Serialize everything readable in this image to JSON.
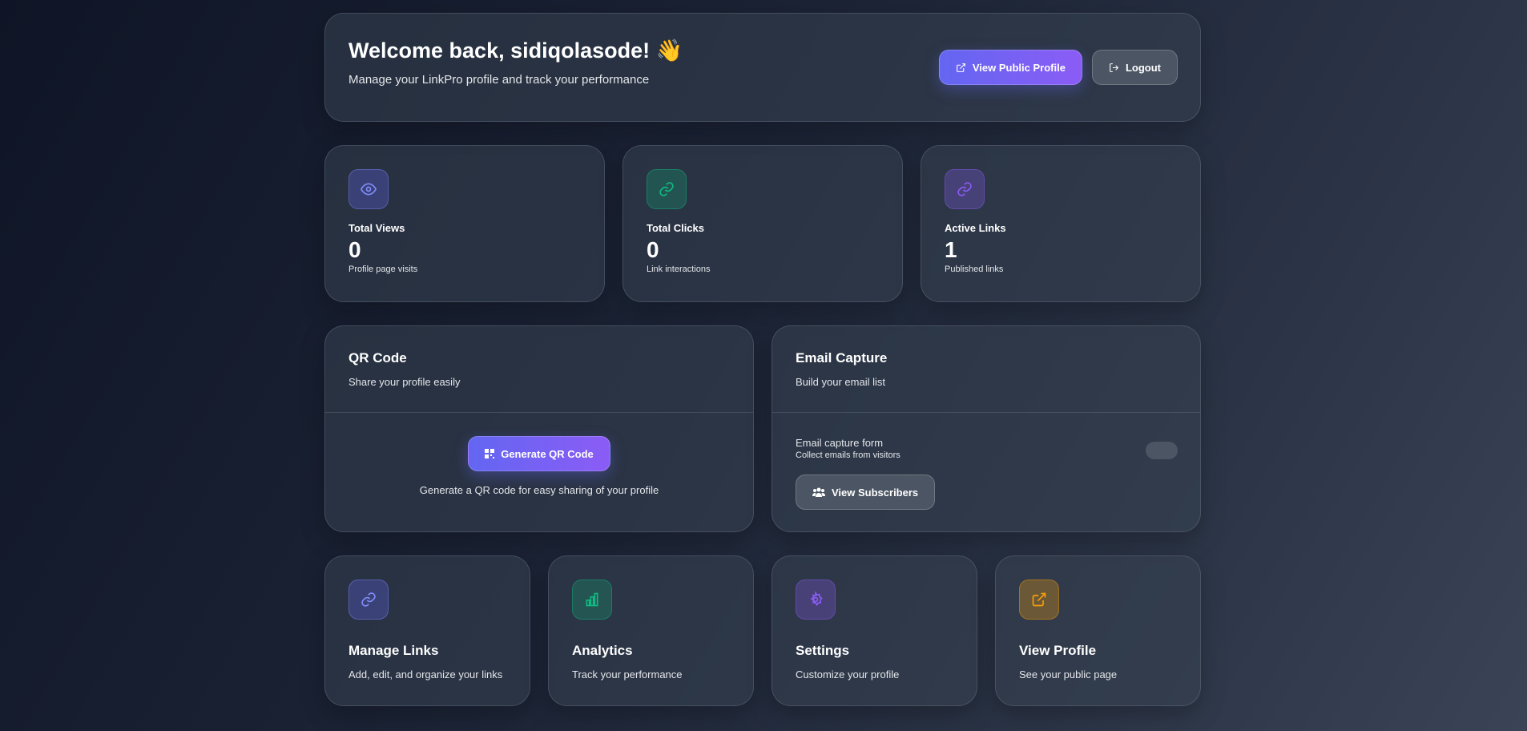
{
  "header": {
    "title": "Welcome back, sidiqolasode!",
    "emoji": "👋",
    "subtitle": "Manage your LinkPro profile and track your performance",
    "view_public_profile": "View Public Profile",
    "logout": "Logout"
  },
  "stats": [
    {
      "label": "Total Views",
      "value": "0",
      "sub": "Profile page visits",
      "icon": "eye-icon",
      "color": "#818cf8"
    },
    {
      "label": "Total Clicks",
      "value": "0",
      "sub": "Link interactions",
      "icon": "link-icon",
      "color": "#10b981"
    },
    {
      "label": "Active Links",
      "value": "1",
      "sub": "Published links",
      "icon": "link-icon",
      "color": "#8b5cf6"
    }
  ],
  "qr": {
    "title": "QR Code",
    "subtitle": "Share your profile easily",
    "button": "Generate QR Code",
    "description": "Generate a QR code for easy sharing of your profile"
  },
  "email": {
    "title": "Email Capture",
    "subtitle": "Build your email list",
    "form_label": "Email capture form",
    "form_sub": "Collect emails from visitors",
    "toggle_on": false,
    "button": "View Subscribers"
  },
  "actions": [
    {
      "title": "Manage Links",
      "desc": "Add, edit, and organize your links",
      "icon": "link-icon",
      "color": "#818cf8"
    },
    {
      "title": "Analytics",
      "desc": "Track your performance",
      "icon": "bar-chart-icon",
      "color": "#10b981"
    },
    {
      "title": "Settings",
      "desc": "Customize your profile",
      "icon": "gear-icon",
      "color": "#8b5cf6"
    },
    {
      "title": "View Profile",
      "desc": "See your public page",
      "icon": "external-link-icon",
      "color": "#f59e0b"
    }
  ]
}
